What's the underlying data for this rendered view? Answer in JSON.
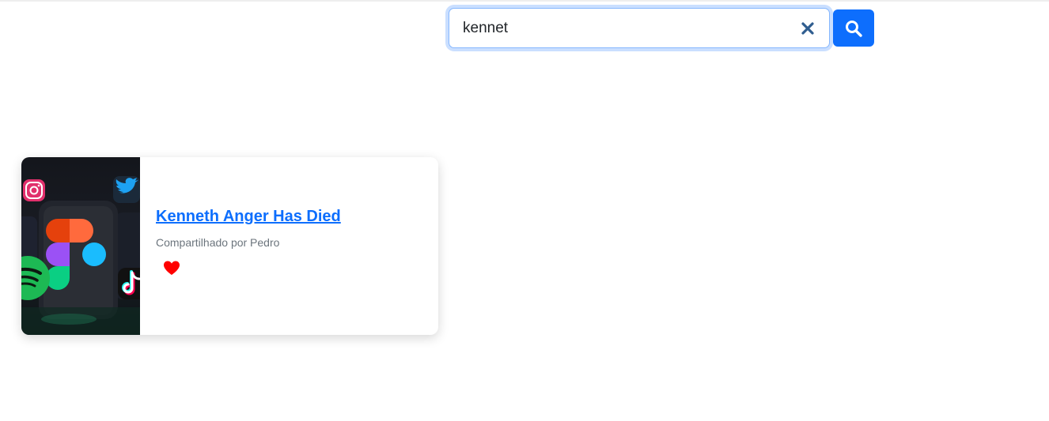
{
  "search": {
    "value": "kennet",
    "clear_icon": "close-icon",
    "search_icon": "search-icon",
    "accent_color": "#0d6efd"
  },
  "results": [
    {
      "title": "Kenneth Anger Has Died",
      "shared_by": "Compartilhado por Pedro",
      "like_icon": "heart-icon",
      "like_color": "#ff0000",
      "thumbnail_icons": [
        "instagram-icon",
        "twitter-icon",
        "figma-icon",
        "spotify-icon",
        "tiktok-icon"
      ]
    }
  ]
}
